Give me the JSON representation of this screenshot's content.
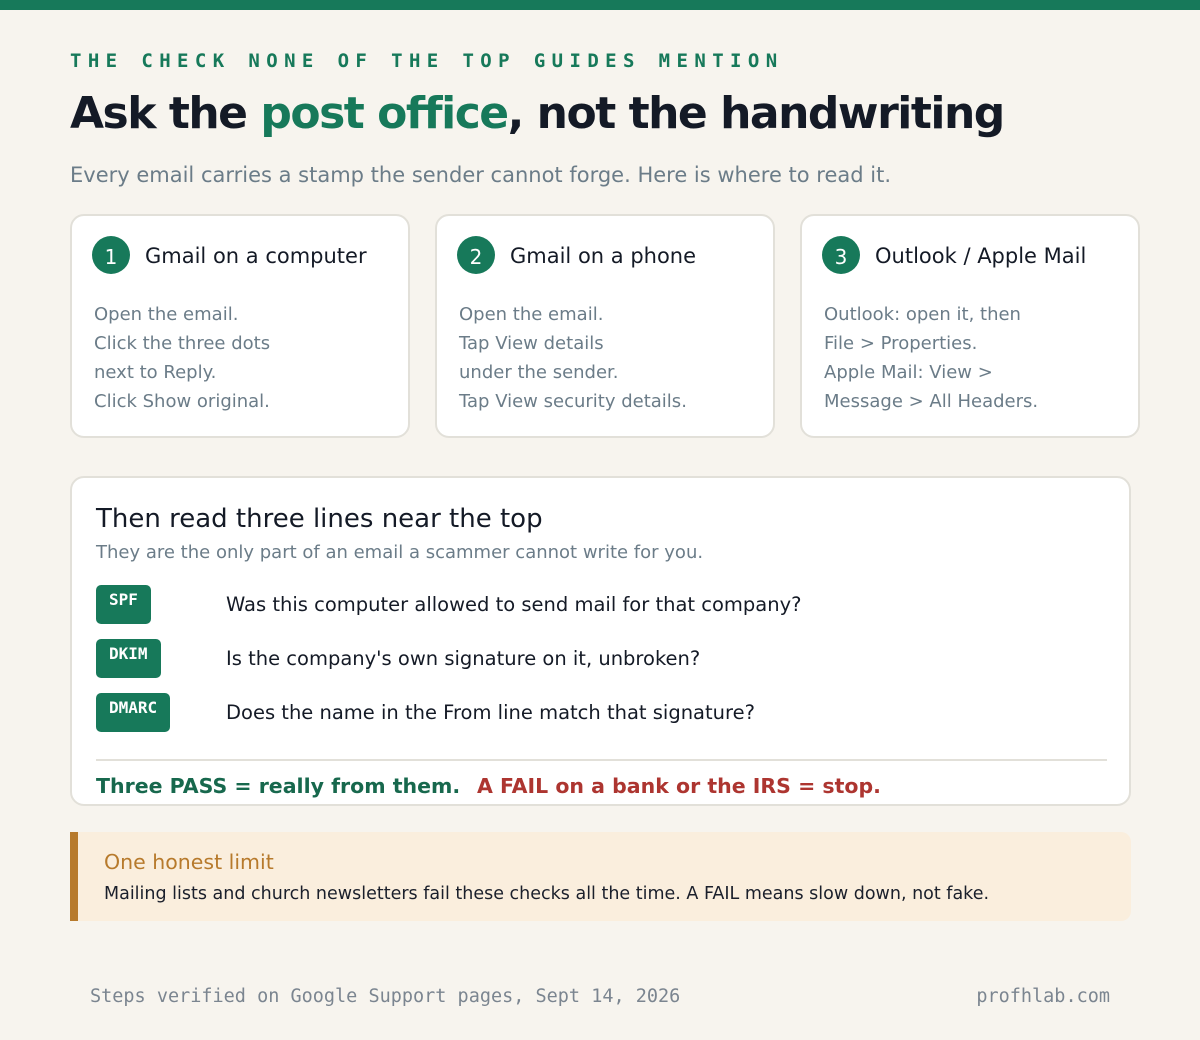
{
  "kicker": "THE CHECK NONE OF THE TOP GUIDES MENTION",
  "headline": {
    "part1": "Ask the ",
    "accent": "post office",
    "part2": ", not the handwriting"
  },
  "subhead": "Every email carries a stamp the sender cannot forge. Here is where to read it.",
  "cards": [
    {
      "num": "1",
      "title": "Gmail on a computer",
      "lines": [
        "Open the email.",
        "Click the three dots",
        "next to Reply.",
        "Click Show original."
      ]
    },
    {
      "num": "2",
      "title": "Gmail on a phone",
      "lines": [
        "Open the email.",
        "Tap View details",
        "under the sender.",
        "Tap View security details."
      ]
    },
    {
      "num": "3",
      "title": "Outlook / Apple Mail",
      "lines": [
        "Outlook: open it, then",
        "File > Properties.",
        "Apple Mail: View >",
        "Message > All Headers."
      ]
    }
  ],
  "read": {
    "title": "Then read three lines near the top",
    "subtitle": "They are the only part of an email a scammer cannot write for you.",
    "checks": [
      {
        "badge": "SPF",
        "question": "Was this computer allowed to send mail for that company?"
      },
      {
        "badge": "DKIM",
        "question": "Is the company's own signature on it, unbroken?"
      },
      {
        "badge": "DMARC",
        "question": "Does the name in the From line match that signature?"
      }
    ],
    "pass": "Three PASS = really from them.",
    "fail": "A FAIL on a bank or the IRS = stop."
  },
  "limit": {
    "title": "One honest limit",
    "text": "Mailing lists and church newsletters fail these checks all the time. A FAIL means slow down, not fake."
  },
  "footer": {
    "left": "Steps verified on Google Support pages, Sept 14, 2026",
    "right": "profhlab.com"
  },
  "colors": {
    "accent": "#17795a",
    "fail": "#ad3530",
    "warning": "#b77a2c",
    "background": "#f7f4ee"
  }
}
